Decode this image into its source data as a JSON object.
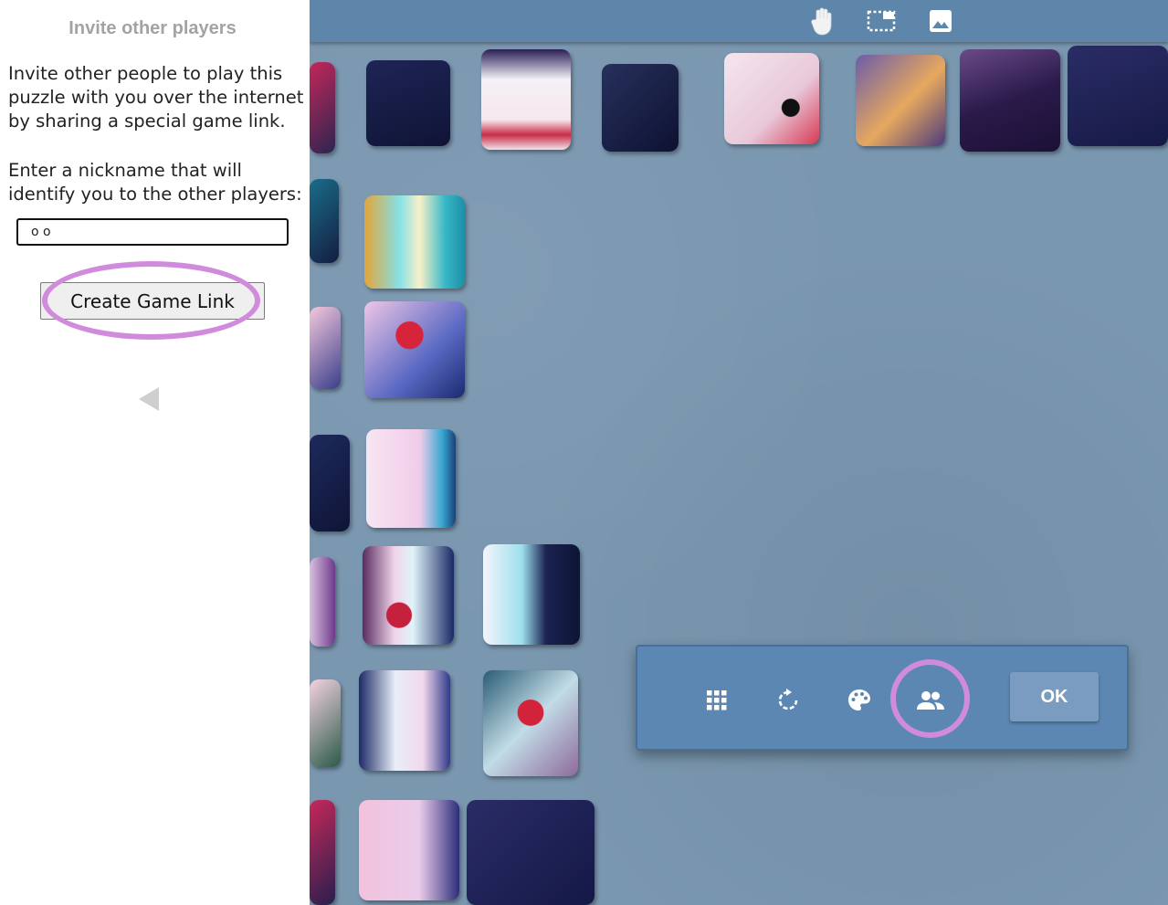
{
  "panel": {
    "title": "Invite other players",
    "intro": "Invite other people to play this puzzle with you over the internet by sharing a special game link.",
    "nickname_prompt": "Enter a nickname that will identify you to the other players:",
    "nickname_value": "o o",
    "create_button": "Create Game Link"
  },
  "topbar": {
    "icons": [
      "hand-icon",
      "select-area-icon",
      "image-icon"
    ]
  },
  "toolbar": {
    "icons": [
      "grid-icon",
      "rotate-icon",
      "palette-icon",
      "players-icon"
    ],
    "ok_label": "OK"
  },
  "colors": {
    "board": "#7a97b0",
    "topbar": "#5e86ab",
    "toolbar": "#5c87b2",
    "highlight": "#d18bdc"
  }
}
